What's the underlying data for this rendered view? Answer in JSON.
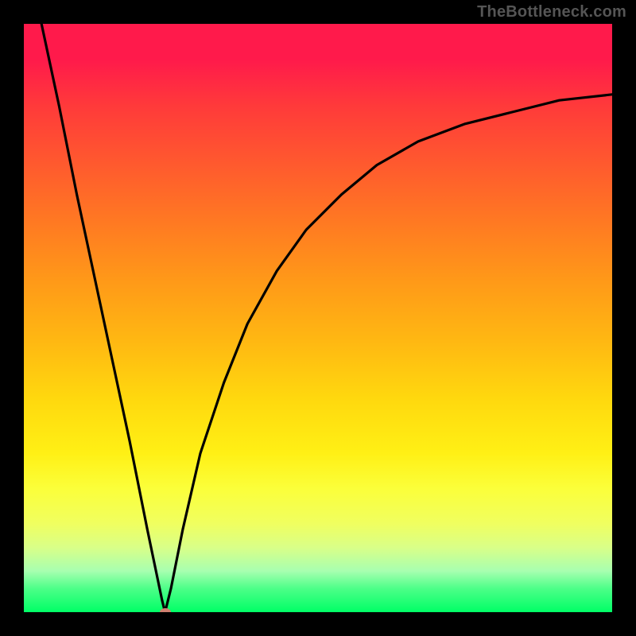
{
  "watermark": "TheBottleneck.com",
  "chart_data": {
    "type": "line",
    "title": "",
    "xlabel": "",
    "ylabel": "",
    "xlim": [
      0,
      100
    ],
    "ylim": [
      0,
      100
    ],
    "grid": false,
    "series": [
      {
        "name": "curve",
        "x": [
          3,
          6,
          9,
          12,
          15,
          18,
          21,
          23.5,
          24,
          25,
          27,
          30,
          34,
          38,
          43,
          48,
          54,
          60,
          67,
          75,
          83,
          91,
          100
        ],
        "y": [
          100,
          86,
          71,
          57,
          43,
          29,
          14,
          2,
          0,
          4,
          14,
          27,
          39,
          49,
          58,
          65,
          71,
          76,
          80,
          83,
          85,
          87,
          88
        ]
      }
    ],
    "min_point": {
      "x": 24,
      "y": 0
    },
    "background": {
      "type": "vertical-gradient",
      "stops": [
        {
          "pos": 0.0,
          "color": "#ff1a4b"
        },
        {
          "pos": 0.5,
          "color": "#ffb812"
        },
        {
          "pos": 0.78,
          "color": "#fbff3a"
        },
        {
          "pos": 1.0,
          "color": "#00ff66"
        }
      ]
    }
  }
}
